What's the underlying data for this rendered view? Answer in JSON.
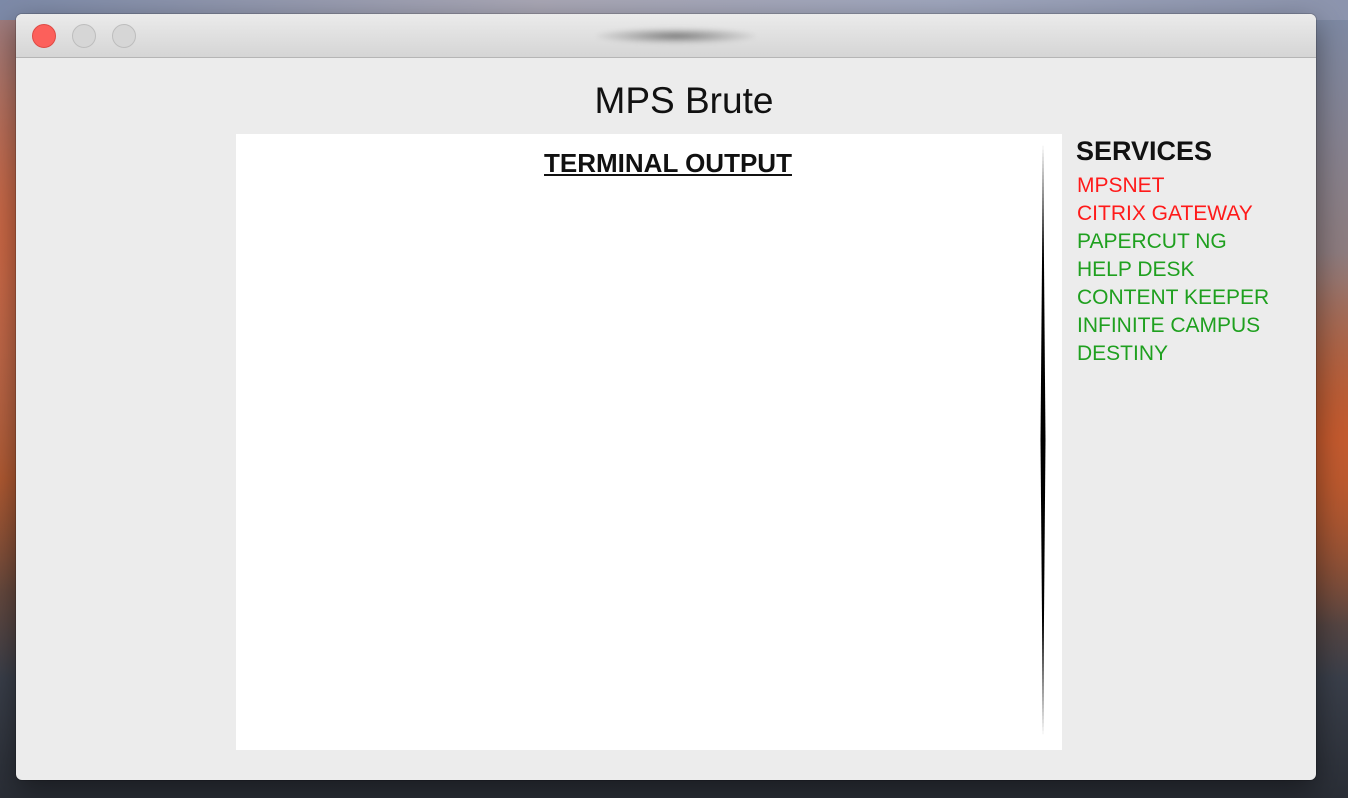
{
  "window": {
    "title_blurred": ""
  },
  "app": {
    "title": "MPS Brute"
  },
  "terminal": {
    "heading": "TERMINAL OUTPUT",
    "output": ""
  },
  "services": {
    "heading": "SERVICES",
    "items": [
      {
        "label": "MPSNET",
        "status": "down",
        "color": "#ff1a1a"
      },
      {
        "label": "CITRIX GATEWAY",
        "status": "down",
        "color": "#ff1a1a"
      },
      {
        "label": "PAPERCUT NG",
        "status": "up",
        "color": "#1fa01f"
      },
      {
        "label": "HELP DESK",
        "status": "up",
        "color": "#1fa01f"
      },
      {
        "label": "CONTENT KEEPER",
        "status": "up",
        "color": "#1fa01f"
      },
      {
        "label": "INFINITE CAMPUS",
        "status": "up",
        "color": "#1fa01f"
      },
      {
        "label": "DESTINY",
        "status": "up",
        "color": "#1fa01f"
      }
    ]
  },
  "colors": {
    "close_button": "#fc605b",
    "service_down": "#ff1a1a",
    "service_up": "#1fa01f"
  },
  "icons": {
    "close": "close-icon",
    "minimize": "minimize-icon",
    "zoom": "zoom-icon"
  }
}
